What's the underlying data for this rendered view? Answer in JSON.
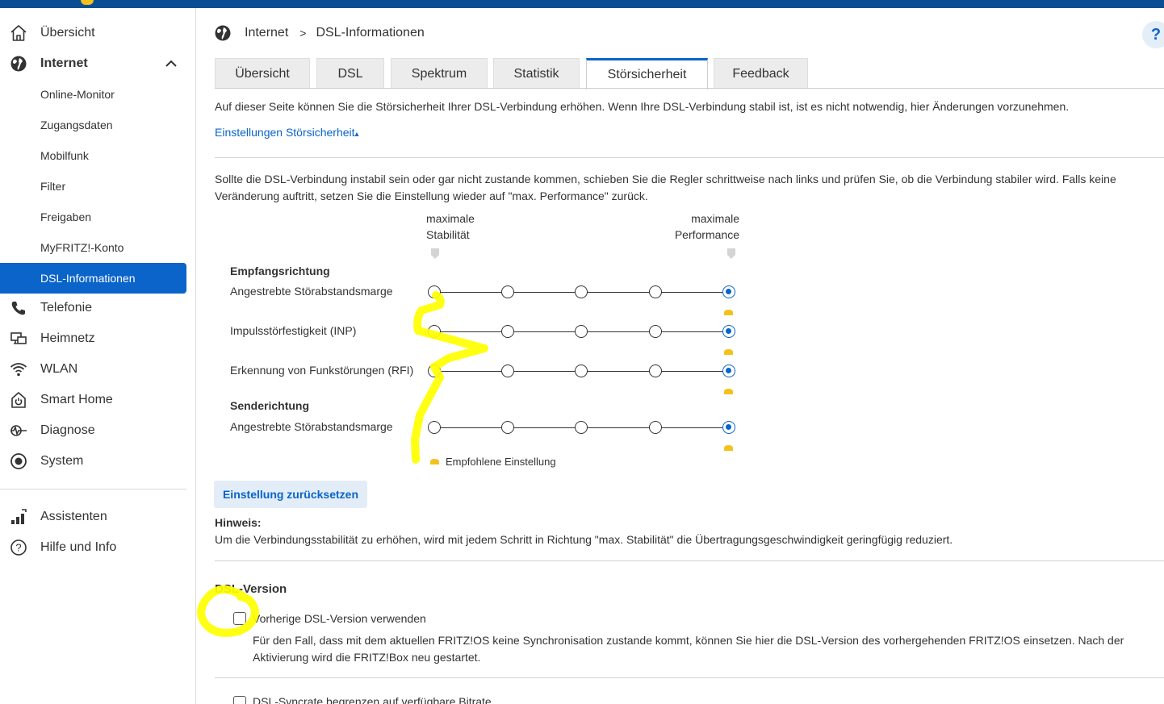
{
  "sidebar": {
    "items": [
      {
        "label": "Übersicht",
        "icon": "home-icon"
      },
      {
        "label": "Internet",
        "icon": "globe-icon"
      },
      {
        "label": "Telefonie",
        "icon": "phone-icon"
      },
      {
        "label": "Heimnetz",
        "icon": "network-icon"
      },
      {
        "label": "WLAN",
        "icon": "wifi-icon"
      },
      {
        "label": "Smart Home",
        "icon": "power-icon"
      },
      {
        "label": "Diagnose",
        "icon": "diagnosis-icon"
      },
      {
        "label": "System",
        "icon": "system-icon"
      },
      {
        "label": "Assistenten",
        "icon": "wizard-icon"
      },
      {
        "label": "Hilfe und Info",
        "icon": "help-icon"
      }
    ],
    "sub_items": [
      {
        "label": "Online-Monitor"
      },
      {
        "label": "Zugangsdaten"
      },
      {
        "label": "Mobilfunk"
      },
      {
        "label": "Filter"
      },
      {
        "label": "Freigaben"
      },
      {
        "label": "MyFRITZ!-Konto"
      },
      {
        "label": "DSL-Informationen",
        "active": true
      }
    ]
  },
  "breadcrumb": {
    "parent": "Internet",
    "separator": ">",
    "current": "DSL-Informationen"
  },
  "help": {
    "label": "?"
  },
  "tabs": [
    {
      "label": "Übersicht"
    },
    {
      "label": "DSL"
    },
    {
      "label": "Spektrum"
    },
    {
      "label": "Statistik"
    },
    {
      "label": "Störsicherheit",
      "active": true
    },
    {
      "label": "Feedback"
    }
  ],
  "content": {
    "intro": "Auf dieser Seite können Sie die Störsicherheit Ihrer DSL-Verbindung erhöhen. Wenn Ihre DSL-Verbindung stabil ist, ist es nicht notwendig, hier Änderungen vorzunehmen.",
    "settings_link": "Einstellungen Störsicherheit",
    "settings_link_arrow": "▴",
    "paragraph": "Sollte die DSL-Verbindung instabil sein oder gar nicht zustande kommen, schieben Sie die Regler schrittweise nach links und prüfen Sie, ob die Verbindung stabiler wird. Falls keine Veränderung auftritt, setzen Sie die Einstellung wieder auf \"max. Performance\" zurück.",
    "scale": {
      "left_line1": "maximale",
      "left_line2": "Stabilität",
      "right_line1": "maximale",
      "right_line2": "Performance"
    },
    "receive_heading": "Empfangsrichtung",
    "send_heading": "Senderichtung",
    "sliders": [
      {
        "label": "Angestrebte Störabstandsmarge",
        "steps": 5,
        "selected": 5,
        "recommended": 5
      },
      {
        "label": "Impulsstörfestigkeit (INP)",
        "steps": 5,
        "selected": 5,
        "recommended": 5
      },
      {
        "label": "Erkennung von Funkstörungen (RFI)",
        "steps": 5,
        "selected": 5,
        "recommended": 5
      },
      {
        "label": "Angestrebte Störabstandsmarge",
        "steps": 5,
        "selected": 5,
        "recommended": 5
      }
    ],
    "legend": "Empfohlene Einstellung",
    "reset_button": "Einstellung zurücksetzen",
    "hint_title": "Hinweis:",
    "hint_text": "Um die Verbindungsstabilität zu erhöhen, wird mit jedem Schritt in Richtung \"max. Stabilität\" die Übertragungsgeschwindigkeit geringfügig reduziert.",
    "dsl_version_title": "DSL-Version",
    "checkbox1_label": "Vorherige DSL-Version verwenden",
    "checkbox1_checked": false,
    "checkbox1_desc": "Für den Fall, dass mit dem aktuellen FRITZ!OS keine Synchronisation zustande kommt, können Sie hier die DSL-Version des vorhergehenden FRITZ!OS einsetzen. Nach der Aktivierung wird die FRITZ!Box neu gestartet.",
    "checkbox2_label": "DSL-Syncrate begrenzen auf verfügbare Bitrate",
    "checkbox2_checked": false
  },
  "colors": {
    "brand_blue": "#0a4f93",
    "accent": "#0a64c9",
    "recommended_marker": "#f3c21a",
    "highlight": "#ffff00"
  }
}
